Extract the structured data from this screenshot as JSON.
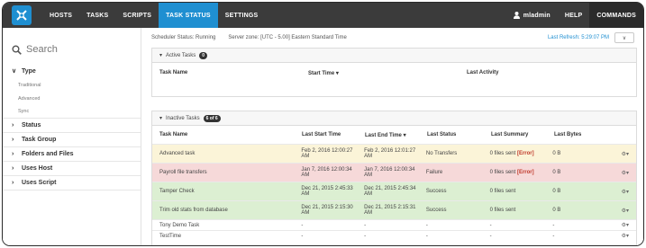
{
  "topnav": {
    "items": [
      "HOSTS",
      "TASKS",
      "SCRIPTS",
      "TASK STATUS",
      "SETTINGS"
    ],
    "user": "mladmin",
    "help": "HELP",
    "commands": "COMMANDS",
    "active_color": "#1f8fd1"
  },
  "sidebar": {
    "search_placeholder": "Search",
    "type_label": "Type",
    "type_items": [
      "Traditional",
      "Advanced",
      "Sync"
    ],
    "groups": [
      "Status",
      "Task Group",
      "Folders and Files",
      "Uses Host",
      "Uses Script"
    ]
  },
  "status": {
    "scheduler": "Scheduler Status: Running",
    "zone": "Server zone: [UTC - 5.00] Eastern Standard Time",
    "last_refresh": "Last Refresh: 5:29:07 PM"
  },
  "active": {
    "title": "Active Tasks",
    "count": "0",
    "headers": [
      "Task Name",
      "Start Time ▾",
      "Last Activity"
    ]
  },
  "inactive": {
    "title": "Inactive Tasks",
    "count": "6 of 6",
    "headers": [
      "Task Name",
      "Last Start Time",
      "Last End Time ▾",
      "Last Status",
      "Last Summary",
      "Last Bytes"
    ],
    "rows": [
      {
        "name": "Advanced task",
        "start": "Feb 2, 2016 12:00:27 AM",
        "end": "Feb 2, 2016 12:01:27 AM",
        "status": "No Transfers",
        "summary": "0 files sent",
        "error": "[Error]",
        "bytes": "0 B"
      },
      {
        "name": "Payroll file transfers",
        "start": "Jan 7, 2016 12:00:34 AM",
        "end": "Jan 7, 2016 12:00:34 AM",
        "status": "Failure",
        "summary": "0 files sent",
        "error": "[Error]",
        "bytes": "0 B"
      },
      {
        "name": "Tamper Check",
        "start": "Dec 21, 2015 2:45:33 AM",
        "end": "Dec 21, 2015 2:45:34 AM",
        "status": "Success",
        "summary": "0 files sent",
        "error": "",
        "bytes": "0 B"
      },
      {
        "name": "Trim old stats from database",
        "start": "Dec 21, 2015 2:15:30 AM",
        "end": "Dec 21, 2015 2:15:31 AM",
        "status": "Success",
        "summary": "0 files sent",
        "error": "",
        "bytes": "0 B"
      },
      {
        "name": "Tony Demo Task",
        "start": "-",
        "end": "-",
        "status": "-",
        "summary": "-",
        "error": "",
        "bytes": "-"
      },
      {
        "name": "TestTime",
        "start": "-",
        "end": "-",
        "status": "-",
        "summary": "-",
        "error": "",
        "bytes": "-"
      }
    ]
  }
}
